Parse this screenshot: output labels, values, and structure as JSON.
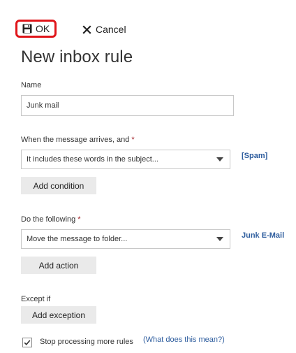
{
  "toolbar": {
    "ok_label": "OK",
    "cancel_label": "Cancel"
  },
  "page_title": "New inbox rule",
  "name_field": {
    "label": "Name",
    "value": "Junk mail"
  },
  "condition": {
    "label": "When the message arrives, and",
    "required_marker": "*",
    "selected": "It includes these words in the subject...",
    "side_value": "[Spam]",
    "add_button": "Add condition"
  },
  "action": {
    "label": "Do the following",
    "required_marker": "*",
    "selected": "Move the message to folder...",
    "side_value": "Junk E-Mail",
    "add_button": "Add action"
  },
  "exception": {
    "label": "Except if",
    "add_button": "Add exception"
  },
  "stop_processing": {
    "checked": true,
    "label": "Stop processing more rules",
    "help_link": "(What does this mean?)"
  },
  "colors": {
    "highlight_border": "#e0151a",
    "link": "#2e5d9e",
    "required": "#a4262c",
    "button_bg": "#eaeaea"
  },
  "icons": {
    "ok": "save-icon",
    "cancel": "close-icon",
    "dropdown": "chevron-down-icon",
    "checkbox": "checkmark-icon"
  }
}
